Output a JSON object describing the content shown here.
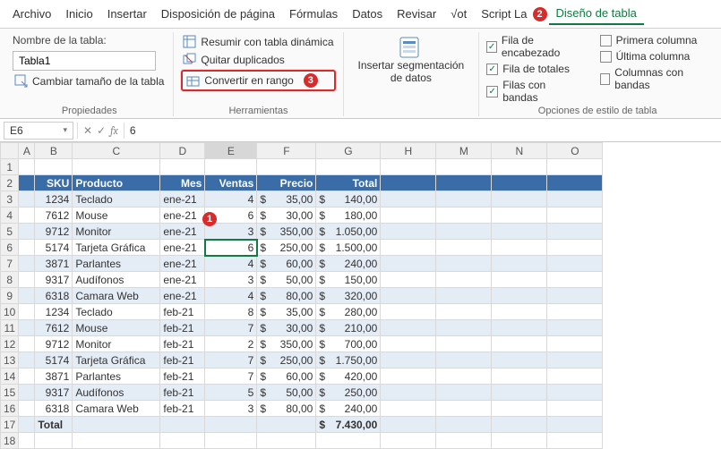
{
  "menu": {
    "archivo": "Archivo",
    "inicio": "Inicio",
    "insertar": "Insertar",
    "disposicion": "Disposición de página",
    "formulas": "Fórmulas",
    "datos": "Datos",
    "revisar": "Revisar",
    "vot": "√ot",
    "script": "Script La",
    "diseno": "Diseño de tabla"
  },
  "callouts": {
    "one": "1",
    "two": "2",
    "three": "3"
  },
  "props": {
    "name_label": "Nombre de la tabla:",
    "table_name": "Tabla1",
    "resize": "Cambiar tamaño de la tabla",
    "group": "Propiedades"
  },
  "tools": {
    "pivot": "Resumir con tabla dinámica",
    "dedup": "Quitar duplicados",
    "range": "Convertir en rango",
    "group": "Herramientas"
  },
  "seg": {
    "line1": "Insertar segmentación",
    "line2": "de datos"
  },
  "styleopts": {
    "header": "Fila de encabezado",
    "totals": "Fila de totales",
    "banded_rows": "Filas con bandas",
    "first_col": "Primera columna",
    "last_col": "Última columna",
    "banded_cols": "Columnas con bandas",
    "group": "Opciones de estilo de tabla"
  },
  "fbar": {
    "ref": "E6",
    "fx": "fx",
    "val": "6",
    "x": "✕",
    "chk": "✓"
  },
  "columns": [
    "",
    "A",
    "B",
    "C",
    "D",
    "E",
    "F",
    "G",
    "H",
    "M",
    "N",
    "O"
  ],
  "table_headers": {
    "sku": "SKU",
    "producto": "Producto",
    "mes": "Mes",
    "ventas": "Ventas",
    "precio": "Precio",
    "total": "Total"
  },
  "total_label": "Total",
  "grand_total": "7.430,00",
  "rows": [
    {
      "r": 3,
      "sku": "1234",
      "prod": "Teclado",
      "mes": "ene-21",
      "ventas": "4",
      "precio": "35,00",
      "total": "140,00",
      "band": true
    },
    {
      "r": 4,
      "sku": "7612",
      "prod": "Mouse",
      "mes": "ene-21",
      "ventas": "6",
      "precio": "30,00",
      "total": "180,00",
      "band": false
    },
    {
      "r": 5,
      "sku": "9712",
      "prod": "Monitor",
      "mes": "ene-21",
      "ventas": "3",
      "precio": "350,00",
      "total": "1.050,00",
      "band": true
    },
    {
      "r": 6,
      "sku": "5174",
      "prod": "Tarjeta Gráfica",
      "mes": "ene-21",
      "ventas": "6",
      "precio": "250,00",
      "total": "1.500,00",
      "band": false,
      "sel": true
    },
    {
      "r": 7,
      "sku": "3871",
      "prod": "Parlantes",
      "mes": "ene-21",
      "ventas": "4",
      "precio": "60,00",
      "total": "240,00",
      "band": true
    },
    {
      "r": 8,
      "sku": "9317",
      "prod": "Audífonos",
      "mes": "ene-21",
      "ventas": "3",
      "precio": "50,00",
      "total": "150,00",
      "band": false
    },
    {
      "r": 9,
      "sku": "6318",
      "prod": "Camara Web",
      "mes": "ene-21",
      "ventas": "4",
      "precio": "80,00",
      "total": "320,00",
      "band": true
    },
    {
      "r": 10,
      "sku": "1234",
      "prod": "Teclado",
      "mes": "feb-21",
      "ventas": "8",
      "precio": "35,00",
      "total": "280,00",
      "band": false
    },
    {
      "r": 11,
      "sku": "7612",
      "prod": "Mouse",
      "mes": "feb-21",
      "ventas": "7",
      "precio": "30,00",
      "total": "210,00",
      "band": true
    },
    {
      "r": 12,
      "sku": "9712",
      "prod": "Monitor",
      "mes": "feb-21",
      "ventas": "2",
      "precio": "350,00",
      "total": "700,00",
      "band": false
    },
    {
      "r": 13,
      "sku": "5174",
      "prod": "Tarjeta Gráfica",
      "mes": "feb-21",
      "ventas": "7",
      "precio": "250,00",
      "total": "1.750,00",
      "band": true
    },
    {
      "r": 14,
      "sku": "3871",
      "prod": "Parlantes",
      "mes": "feb-21",
      "ventas": "7",
      "precio": "60,00",
      "total": "420,00",
      "band": false
    },
    {
      "r": 15,
      "sku": "9317",
      "prod": "Audífonos",
      "mes": "feb-21",
      "ventas": "5",
      "precio": "50,00",
      "total": "250,00",
      "band": true
    },
    {
      "r": 16,
      "sku": "6318",
      "prod": "Camara Web",
      "mes": "feb-21",
      "ventas": "3",
      "precio": "80,00",
      "total": "240,00",
      "band": false
    }
  ]
}
